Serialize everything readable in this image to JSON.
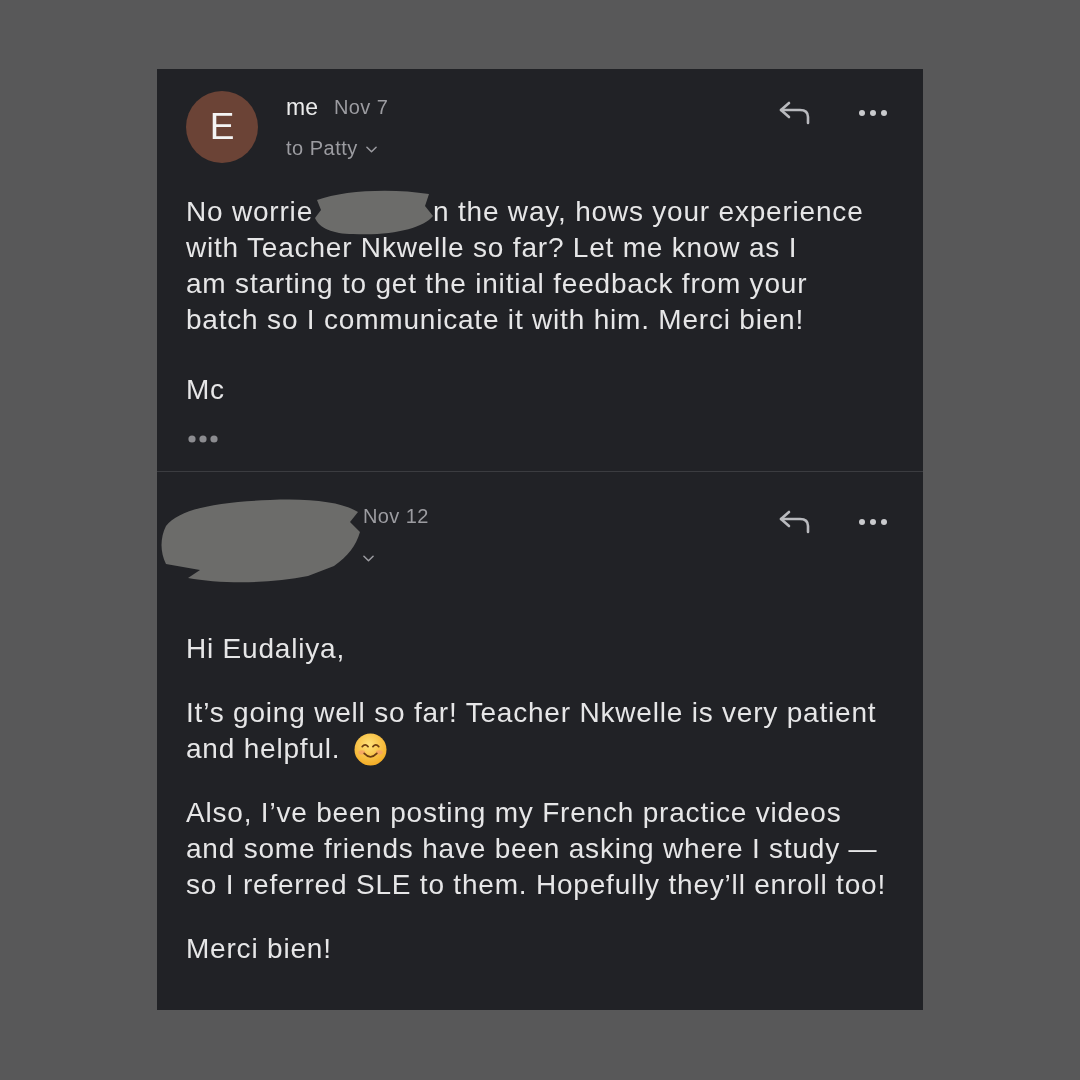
{
  "messages": [
    {
      "kind": "plain",
      "avatar_letter": "E",
      "sender": "me",
      "date": "Nov 7",
      "recipients": "to Patty",
      "paragraphs": [
        {
          "kind": "redacted",
          "before": "No worrie",
          "after": "n the way, hows your experience",
          "rest": "with Teacher Nkwelle so far? Let me know as I\nam starting to get the initial feedback from your\nbatch so I communicate it with him. Merci bien!"
        },
        {
          "kind": "text",
          "text": "Mc"
        }
      ],
      "trimmed_content": true
    },
    {
      "kind": "redacted",
      "date": "Nov 12",
      "paragraphs": [
        {
          "kind": "text",
          "text": "Hi Eudaliya,"
        },
        {
          "kind": "text_with_emoji",
          "lines": [
            "It’s going well so far! Teacher Nkwelle is very patient",
            "and helpful."
          ]
        },
        {
          "kind": "text",
          "text": "Also, I’ve been posting my French practice videos\nand some friends have been asking where I study —\nso I referred SLE to them. Hopefully they’ll enroll too!"
        },
        {
          "kind": "text",
          "text": "Merci bien!"
        }
      ]
    }
  ]
}
